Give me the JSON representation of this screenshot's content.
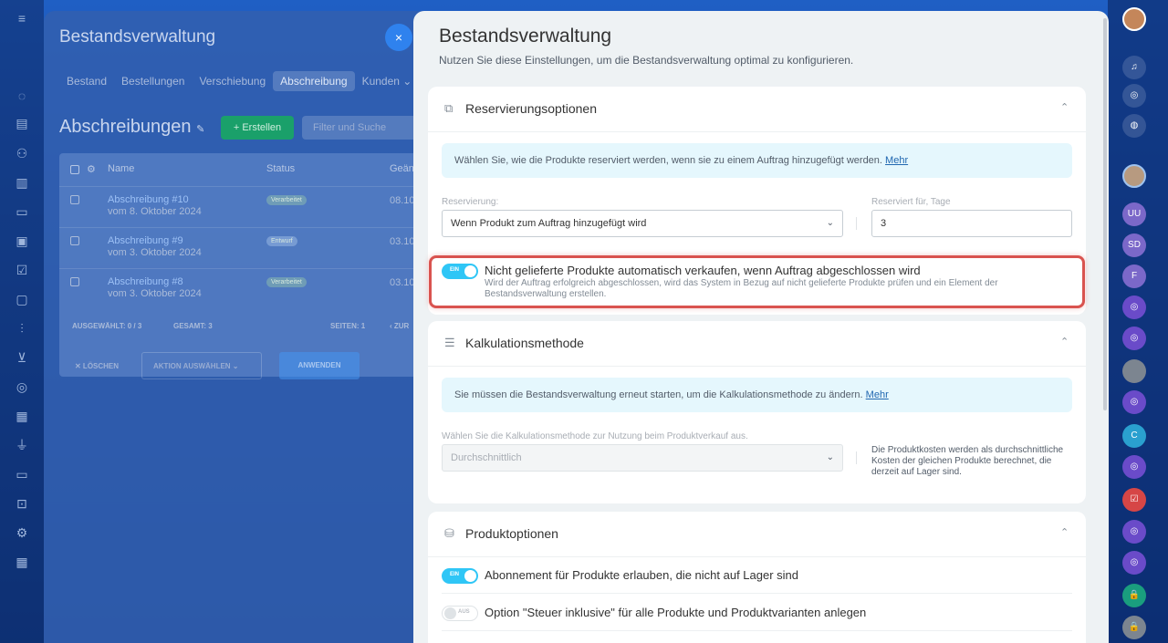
{
  "background_app": {
    "title": "Bestandsverwaltung",
    "close_icon": "×",
    "tabs": [
      "Bestand",
      "Bestellungen",
      "Verschiebung",
      "Abschreibung",
      "Kunden ⌄"
    ],
    "active_tab": "Abschreibung",
    "heading": "Abschreibungen",
    "create_button": "+ Erstellen",
    "filter_placeholder": "Filter und Suche",
    "columns": [
      "Name",
      "Status",
      "Geän"
    ],
    "rows": [
      {
        "name": "Abschreibung #10",
        "date": "vom 8. Oktober 2024",
        "status": "Verarbeitet",
        "changed": "08.10"
      },
      {
        "name": "Abschreibung #9",
        "date": "vom 3. Oktober 2024",
        "status": "Entwurf",
        "changed": "03.10"
      },
      {
        "name": "Abschreibung #8",
        "date": "vom 3. Oktober 2024",
        "status": "Verarbeitet",
        "changed": "03.10"
      }
    ],
    "footer": {
      "selected": "AUSGEWÄHLT: 0 / 3",
      "total": "GESAMT: 3",
      "pages": "SEITEN: 1",
      "prev": "‹ ZUR"
    },
    "delete": "✕ LÖSCHEN",
    "choose_action": "AKTION AUSWÄHLEN ⌄",
    "apply": "ANWENDEN"
  },
  "panel": {
    "title": "Bestandsverwaltung",
    "subtitle": "Nutzen Sie diese Einstellungen, um die Bestandsverwaltung optimal zu konfigurieren.",
    "reservation": {
      "title": "Reservierungsoptionen",
      "info": "Wählen Sie, wie die Produkte reserviert werden, wenn sie zu einem Auftrag hinzugefügt werden.",
      "more": "Mehr",
      "reserve_label": "Reservierung:",
      "reserve_value": "Wenn Produkt zum Auftrag hinzugefügt wird",
      "days_label": "Reserviert für, Tage",
      "days_value": "3",
      "toggle_on_label": "EIN",
      "auto_sell_title": "Nicht gelieferte Produkte automatisch verkaufen, wenn Auftrag abgeschlossen wird",
      "auto_sell_desc": "Wird der Auftrag erfolgreich abgeschlossen, wird das System in Bezug auf nicht gelieferte Produkte prüfen und ein Element der Bestandsverwaltung erstellen."
    },
    "calculation": {
      "title": "Kalkulationsmethode",
      "info": "Sie müssen die Bestandsverwaltung erneut starten, um die Kalkulationsmethode zu ändern.",
      "more": "Mehr",
      "method_label": "Wählen Sie die Kalkulationsmethode zur Nutzung beim Produktverkauf aus.",
      "method_value": "Durchschnittlich",
      "method_desc": "Die Produktkosten werden als durchschnittliche Kosten der gleichen Produkte berechnet, die derzeit auf Lager sind."
    },
    "products": {
      "title": "Produktoptionen",
      "subscription_label": "Abonnement für Produkte erlauben, die nicht auf Lager sind",
      "subscription_toggle": "EIN",
      "tax_label": "Option \"Steuer inklusive\" für alle Produkte und Produktvarianten anlegen",
      "tax_toggle": "AUS"
    }
  },
  "colors": {
    "accent": "#2fc6f6",
    "link": "#2067b0",
    "highlight": "#d9534f",
    "info_bg": "#e5f7fd"
  }
}
